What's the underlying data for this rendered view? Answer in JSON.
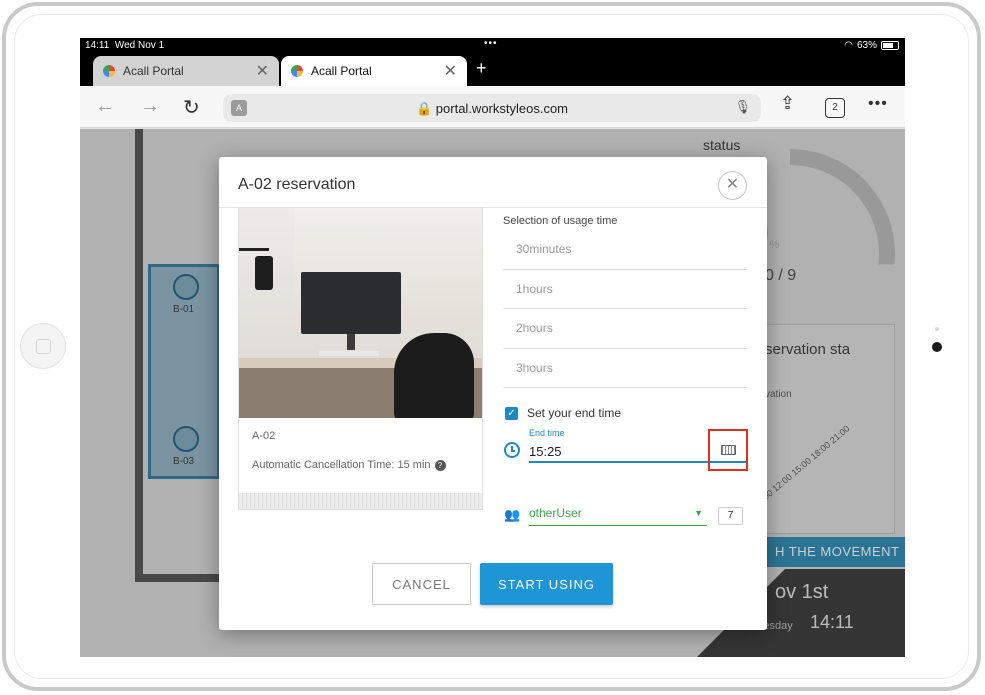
{
  "statusbar": {
    "time": "14:11",
    "date": "Wed Nov 1",
    "battery": "63%"
  },
  "tabs": [
    {
      "label": "Acall Portal",
      "active": false
    },
    {
      "label": "Acall Portal",
      "active": true
    }
  ],
  "browser": {
    "url": "portal.workstyleos.com",
    "tab_count": "2"
  },
  "background": {
    "seats": [
      "B-01",
      "B-03"
    ],
    "status_heading": "status",
    "percent_glyph": "0",
    "percent_unit": "%",
    "count": "0 / 9",
    "reservation_status_title": "servation sta",
    "reservation_sub": "vation",
    "chart_ticks": "9:00 12:00 15:00 18:00 21:00",
    "movement_bar": "H THE MOVEMENT",
    "date": "ov 1st",
    "weekday": "ednesday",
    "clock": "14:11"
  },
  "modal": {
    "title": "A-02 reservation",
    "room_name": "A-02",
    "auto_cancel": "Automatic Cancellation Time: 15 min",
    "usage_label": "Selection of usage time",
    "usage_options": [
      "30minutes",
      "1hours",
      "2hours",
      "3hours"
    ],
    "set_end_time_label": "Set your end time",
    "set_end_time_checked": true,
    "end_time_caption": "End time",
    "end_time_value": "15:25",
    "user_select_value": "otherUser",
    "user_count": "7",
    "cancel_label": "CANCEL",
    "start_label": "START USING"
  },
  "colors": {
    "accent": "#1e95d4",
    "user_green": "#3ba44a",
    "highlight_red": "#e0301e"
  }
}
